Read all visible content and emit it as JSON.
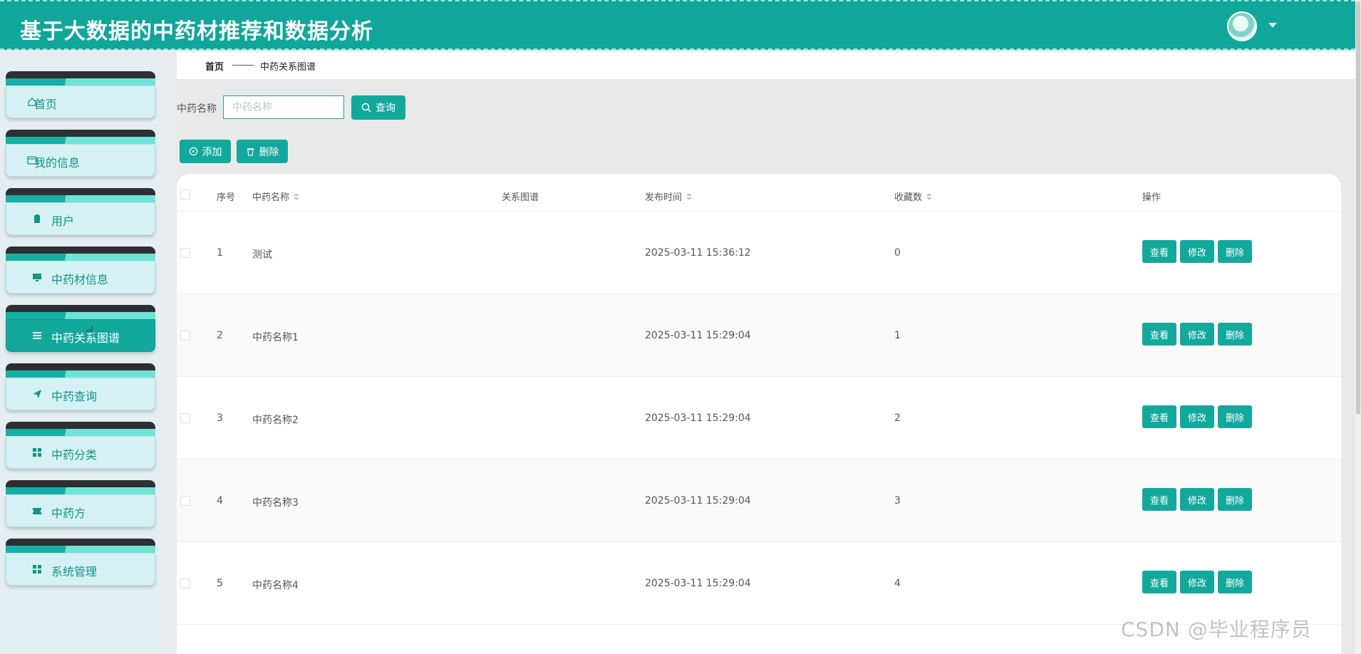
{
  "header": {
    "title": "基于大数据的中药材推荐和数据分析"
  },
  "sidebar": {
    "items": [
      {
        "label": "首页",
        "icon": "home-icon",
        "active": false
      },
      {
        "label": "我的信息",
        "icon": "id-card-icon",
        "active": false
      },
      {
        "label": "用户",
        "icon": "clipboard-icon",
        "active": false
      },
      {
        "label": "中药材信息",
        "icon": "monitor-icon",
        "active": false
      },
      {
        "label": "中药关系图谱",
        "icon": "list-icon",
        "active": true
      },
      {
        "label": "中药查询",
        "icon": "send-icon",
        "active": false
      },
      {
        "label": "中药分类",
        "icon": "grid-icon",
        "active": false
      },
      {
        "label": "中药方",
        "icon": "ticket-icon",
        "active": false
      },
      {
        "label": "系统管理",
        "icon": "grid-icon",
        "active": false
      }
    ]
  },
  "breadcrumb": {
    "home": "首页",
    "current": "中药关系图谱"
  },
  "search": {
    "label": "中药名称",
    "placeholder": "中药名称",
    "query_label": "查询"
  },
  "toolbar": {
    "add_label": "添加",
    "delete_label": "删除"
  },
  "table": {
    "columns": [
      "序号",
      "中药名称",
      "关系图谱",
      "发布时间",
      "收藏数",
      "操作"
    ],
    "rows": [
      {
        "index": "1",
        "name": "测试",
        "graph": "",
        "time": "2025-03-11 15:36:12",
        "favorites": "0"
      },
      {
        "index": "2",
        "name": "中药名称1",
        "graph": "",
        "time": "2025-03-11 15:29:04",
        "favorites": "1"
      },
      {
        "index": "3",
        "name": "中药名称2",
        "graph": "",
        "time": "2025-03-11 15:29:04",
        "favorites": "2"
      },
      {
        "index": "4",
        "name": "中药名称3",
        "graph": "",
        "time": "2025-03-11 15:29:04",
        "favorites": "3"
      },
      {
        "index": "5",
        "name": "中药名称4",
        "graph": "",
        "time": "2025-03-11 15:29:04",
        "favorites": "4"
      }
    ],
    "actions": {
      "view": "查看",
      "edit": "修改",
      "delete": "删除"
    }
  },
  "watermark": "CSDN @毕业程序员",
  "colors": {
    "accent": "#13a89c",
    "header": "#11a69a",
    "sidebar_tab": "#d6f1f3"
  }
}
